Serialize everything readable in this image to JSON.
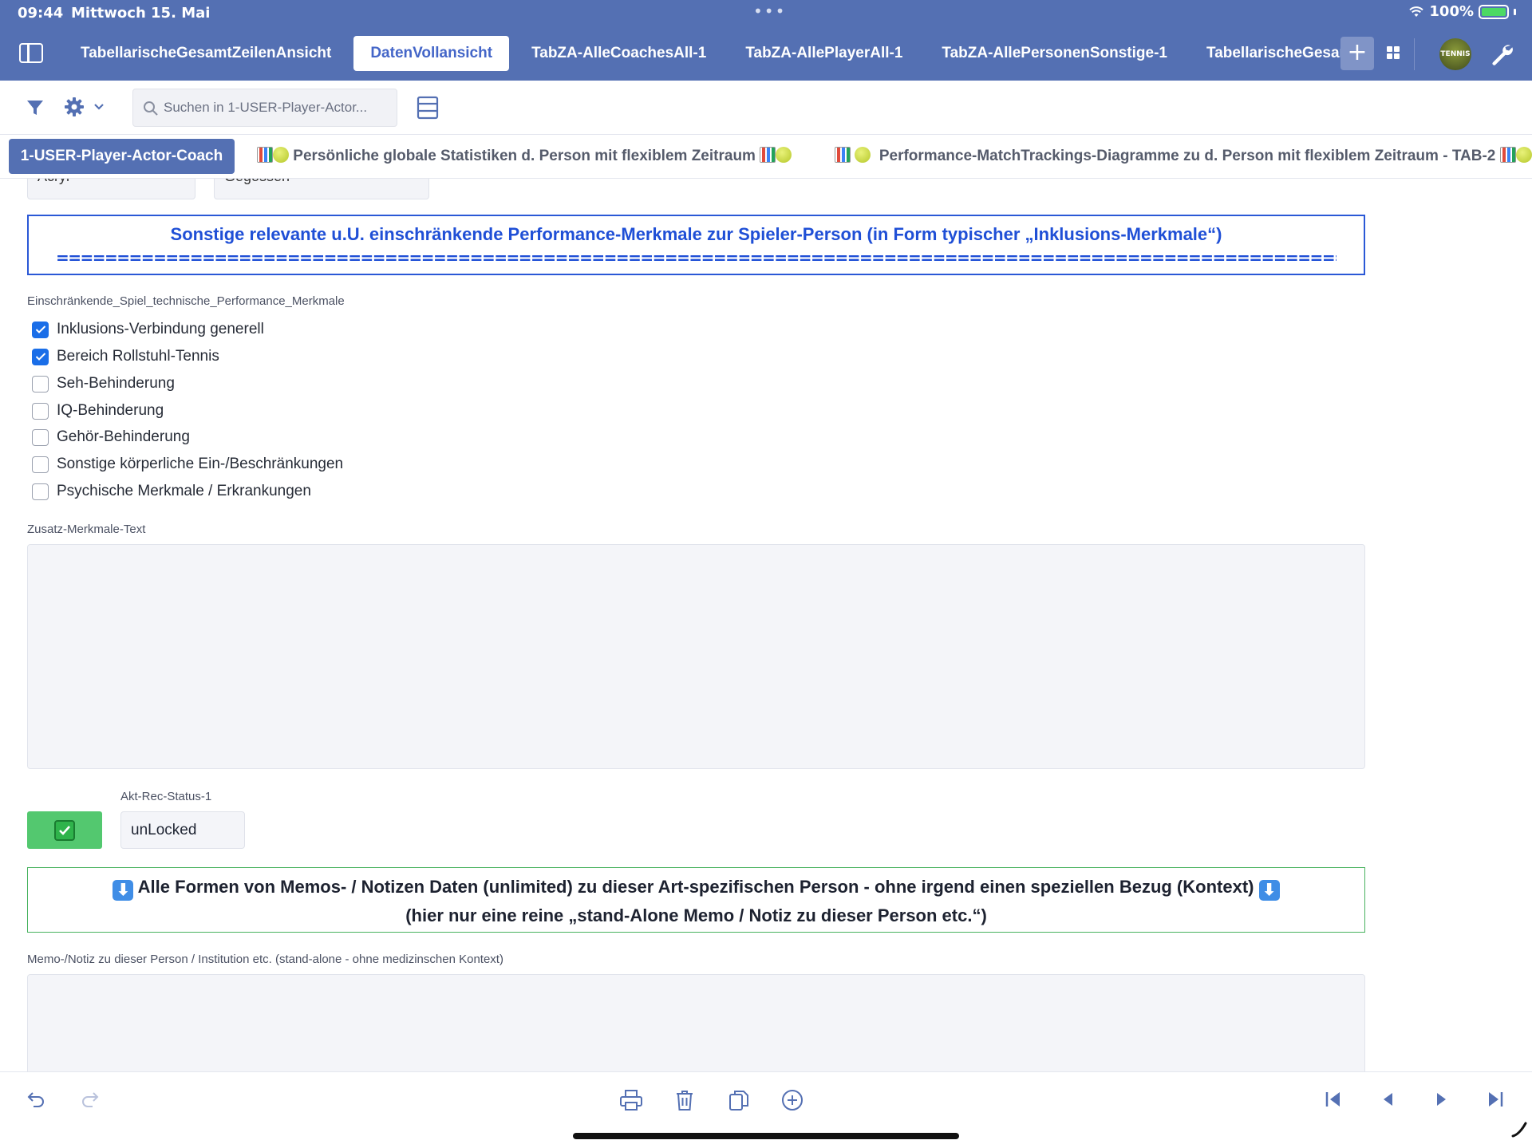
{
  "status_bar": {
    "time": "09:44",
    "date": "Mittwoch 15. Mai",
    "battery": "100%"
  },
  "top_tabs": [
    {
      "label": "TabellarischeGesamtZeilenAnsicht",
      "active": false
    },
    {
      "label": "DatenVollansicht",
      "active": true
    },
    {
      "label": "TabZA-AlleCoachesAll-1",
      "active": false
    },
    {
      "label": "TabZA-AllePlayerAll-1",
      "active": false
    },
    {
      "label": "TabZA-AllePersonenSonstige-1",
      "active": false
    },
    {
      "label": "TabellarischeGesamtZe",
      "active": false
    }
  ],
  "tab_plus": "+",
  "avatar_text": "TENNIS",
  "toolbar": {
    "search_placeholder": "Suchen in 1-USER-Player-Actor..."
  },
  "view_tabs": {
    "active": "1-USER-Player-Actor-Coach",
    "tab2": "Persönliche globale Statistiken d. Person mit flexiblem Zeitraum",
    "tab3": "Performance-MatchTrackings-Diagramme zu d. Person mit flexiblem Zeitraum - TAB-2"
  },
  "cut_selects": [
    "Acryl",
    "Gegossen"
  ],
  "section_header": {
    "title": "Sonstige relevante u.U. einschränkende Performance-Merkmale zur Spieler-Person (in Form typischer „Inklusions-Merkmale“)",
    "rule": "=============================================================================================================================================="
  },
  "checkbox_group": {
    "label": "Einschränkende_Spiel_technische_Performance_Merkmale",
    "items": [
      {
        "label": "Inklusions-Verbindung generell",
        "checked": true
      },
      {
        "label": "Bereich Rollstuhl-Tennis",
        "checked": true
      },
      {
        "label": "Seh-Behinderung",
        "checked": false
      },
      {
        "label": "IQ-Behinderung",
        "checked": false
      },
      {
        "label": "Gehör-Behinderung",
        "checked": false
      },
      {
        "label": "Sonstige körperliche Ein-/Beschränkungen",
        "checked": false
      },
      {
        "label": "Psychische Merkmale / Erkrankungen",
        "checked": false
      }
    ]
  },
  "zusatz": {
    "label": "Zusatz-Merkmale-Text",
    "value": ""
  },
  "rec_status": {
    "label": "Akt-Rec-Status-1",
    "value": "unLocked"
  },
  "memo_header": {
    "line1": "Alle Formen von Memos- / Notizen Daten (unlimited) zu dieser Art-spezifischen Person - ohne irgend einen speziellen Bezug (Kontext)",
    "line2": "(hier nur eine reine „stand-Alone Memo / Notiz zu dieser Person etc.“)"
  },
  "memo": {
    "label": "Memo-/Notiz zu dieser Person / Institution etc. (stand-alone - ohne medizinschen Kontext)",
    "value": ""
  },
  "colors": {
    "chrome": "#5470b3",
    "accent_blue": "#1f4fd6",
    "ok_green": "#53c86f"
  }
}
